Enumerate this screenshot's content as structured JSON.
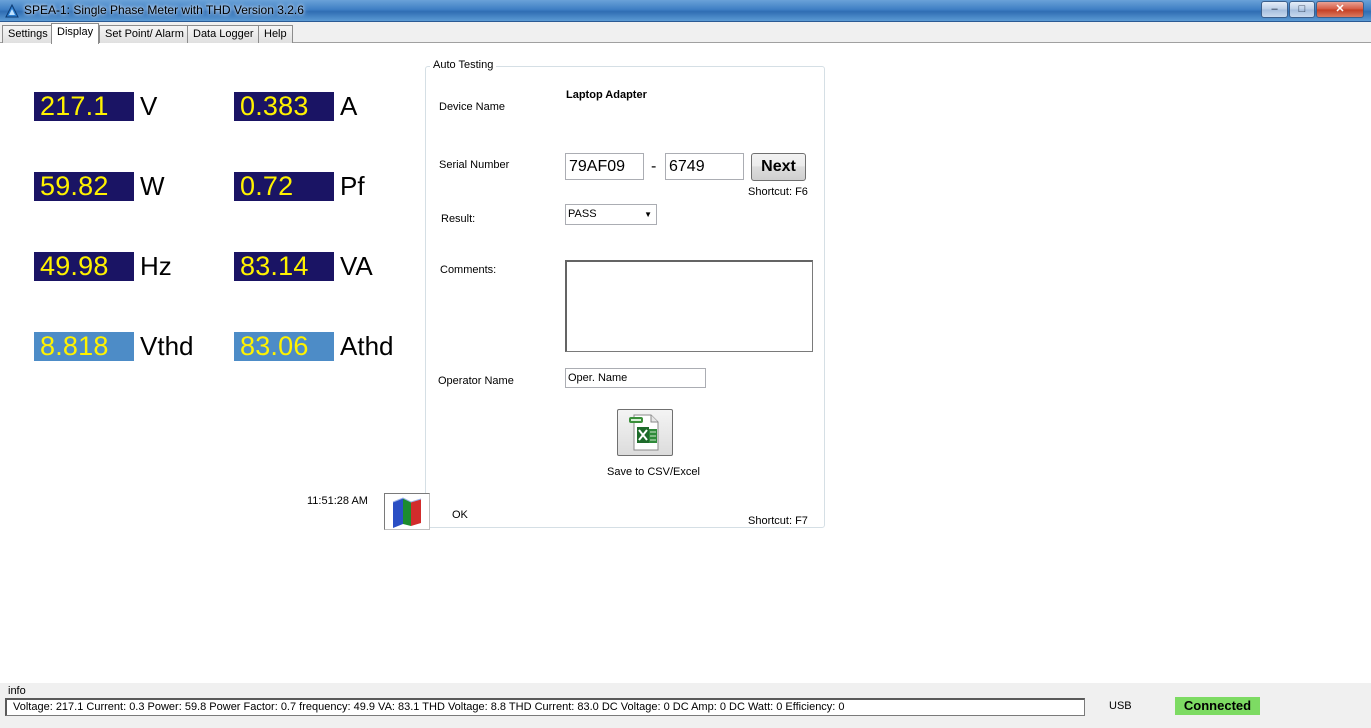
{
  "window": {
    "title": "SPEA-1: Single Phase Meter with THD Version 3.2.6",
    "minimize": "–",
    "maximize": "□",
    "close": "✕"
  },
  "tabs": [
    {
      "label": "Settings",
      "active": false
    },
    {
      "label": "Display",
      "active": true
    },
    {
      "label": "Set Point/ Alarm",
      "active": false
    },
    {
      "label": "Data Logger",
      "active": false
    },
    {
      "label": "Help",
      "active": false
    }
  ],
  "readings": [
    {
      "value": "217.1",
      "unit": "V"
    },
    {
      "value": "0.383",
      "unit": "A"
    },
    {
      "value": "59.82",
      "unit": "W"
    },
    {
      "value": "0.72",
      "unit": "Pf"
    },
    {
      "value": "49.98",
      "unit": "Hz"
    },
    {
      "value": "83.14",
      "unit": "VA"
    },
    {
      "value": "8.818",
      "unit": "Vthd"
    },
    {
      "value": "83.06",
      "unit": "Athd"
    }
  ],
  "colors": {
    "readout_bg": "#1a1464",
    "readout_thd_bg": "#4d8cc7",
    "readout_text": "#fff200",
    "connected_bg": "#7ddb63"
  },
  "auto_testing": {
    "title": "Auto Testing",
    "device_name_label": "Device Name",
    "device_name_value": "Laptop Adapter",
    "serial_label": "Serial Number",
    "serial_part1": "79AF09",
    "serial_dash": "-",
    "serial_part2": "6749",
    "next_label": "Next",
    "next_shortcut": "Shortcut: F6",
    "result_label": "Result:",
    "result_value": "PASS",
    "comments_label": "Comments:",
    "comments_value": "",
    "operator_label": "Operator Name",
    "operator_value": "Oper. Name",
    "csv_icon": "excel-csv-icon",
    "save_caption": "Save to CSV/Excel",
    "save_shortcut": "Shortcut: F7"
  },
  "clock": "11:51:28 AM",
  "ok_label": "OK",
  "status": {
    "info_label": "info",
    "text": "Voltage: 217.1 Current: 0.3 Power: 59.8 Power Factor: 0.7 frequency: 49.9 VA: 83.1 THD Voltage: 8.8 THD Current: 83.0 DC Voltage: 0 DC Amp: 0 DC Watt: 0 Efficiency: 0",
    "port": "USB",
    "connection": "Connected"
  }
}
